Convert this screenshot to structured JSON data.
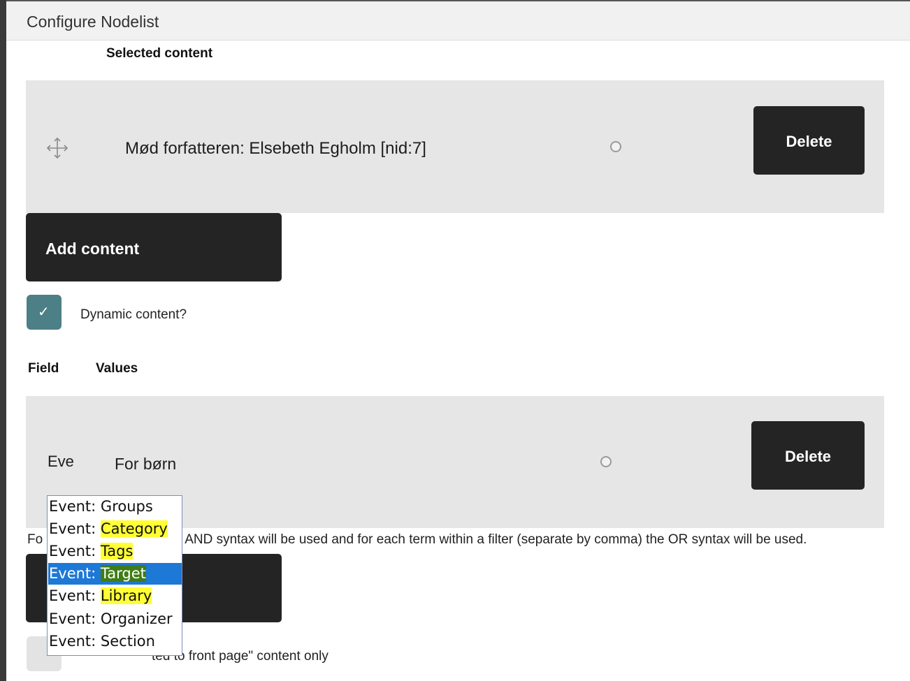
{
  "window": {
    "title": "Configure Nodelist"
  },
  "selected_content": {
    "heading": "Selected content",
    "items": [
      {
        "label": "Mød forfatteren: Elsebeth Egholm [nid:7]",
        "delete_label": "Delete"
      }
    ],
    "add_label": "Add content"
  },
  "dynamic": {
    "checkbox_label": "Dynamic content?",
    "checked": true
  },
  "filters": {
    "headers": {
      "field": "Field",
      "values": "Values"
    },
    "rows": [
      {
        "field": "Eve",
        "value": "For børn",
        "delete_label": "Delete"
      }
    ],
    "help_prefix": "Fo",
    "help_text": "AND syntax will be used and for each term within a filter (separate by comma) the OR syntax will be used."
  },
  "promoted": {
    "label_fragment": "ted to front page\" content only"
  },
  "dropdown": {
    "selected_index": 3,
    "options": [
      {
        "prefix": "Event: ",
        "term": "Groups",
        "highlight": false
      },
      {
        "prefix": "Event: ",
        "term": "Category",
        "highlight": true
      },
      {
        "prefix": "Event: ",
        "term": "Tags",
        "highlight": true
      },
      {
        "prefix": "Event: ",
        "term": "Target",
        "highlight": true
      },
      {
        "prefix": "Event: ",
        "term": "Library",
        "highlight": true
      },
      {
        "prefix": "Event: ",
        "term": "Organizer",
        "highlight": false
      },
      {
        "prefix": "Event: ",
        "term": "Section",
        "highlight": false
      }
    ]
  },
  "icons": {
    "drag": "move-arrows-icon",
    "check": "check-icon"
  },
  "colors": {
    "dark_button": "#242424",
    "checkbox": "#4d7f86",
    "row_bg": "#e6e6e6",
    "highlight": "#ffff33",
    "selection": "#1e78d6"
  }
}
